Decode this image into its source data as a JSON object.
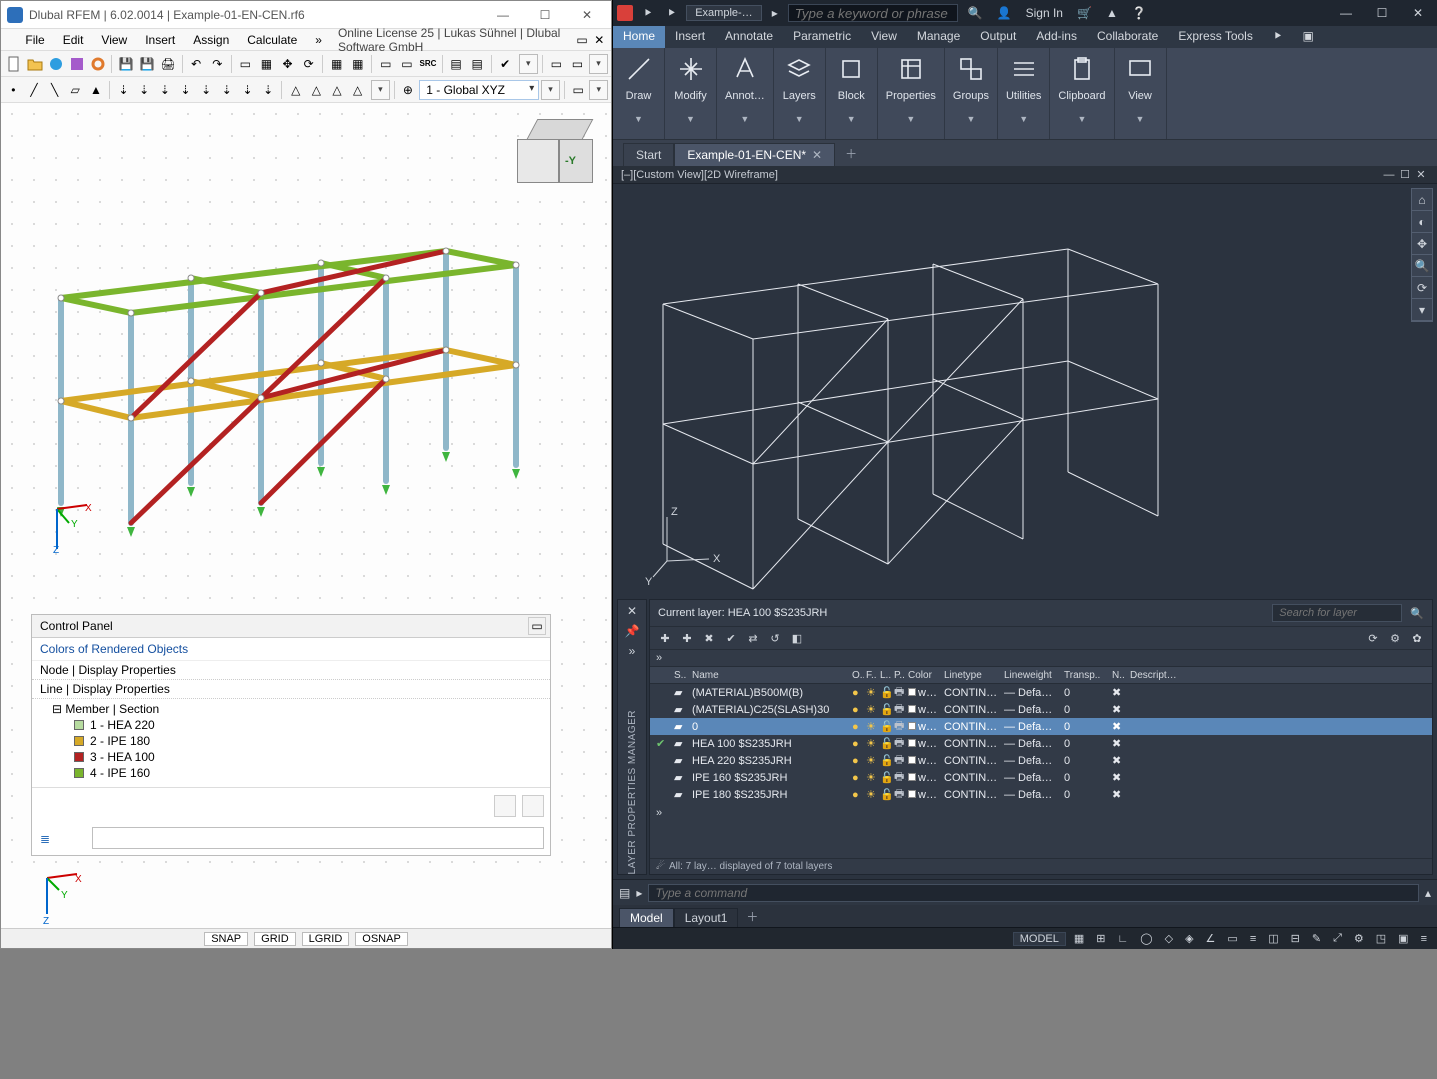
{
  "left": {
    "title": "Dlubal RFEM | 6.02.0014 | Example-01-EN-CEN.rf6",
    "menu": [
      "File",
      "Edit",
      "View",
      "Insert",
      "Assign",
      "Calculate"
    ],
    "menu_overflow": "»",
    "right_info": "Online License 25 | Lukas Sühnel | Dlubal Software GmbH",
    "coord_system": "1 - Global XYZ",
    "nav_cube_label": "-Y",
    "axis": {
      "x": "X",
      "y": "Y",
      "z": "Z"
    },
    "control_panel": {
      "title": "Control Panel",
      "subtitle": "Colors of Rendered Objects",
      "rows": [
        "Node | Display Properties",
        "Line | Display Properties"
      ],
      "tree_root": "Member | Section",
      "items": [
        {
          "label": "1 - HEA 220",
          "color": "#b7dca0"
        },
        {
          "label": "2 - IPE 180",
          "color": "#d6a927"
        },
        {
          "label": "3 - HEA 100",
          "color": "#b32222"
        },
        {
          "label": "4 - IPE 160",
          "color": "#7ab52d"
        }
      ]
    },
    "status": [
      "SNAP",
      "GRID",
      "LGRID",
      "OSNAP"
    ]
  },
  "right": {
    "doc_tab": "Example-…",
    "search_ph": "Type a keyword or phrase",
    "signin": "Sign In",
    "menu": [
      "Home",
      "Insert",
      "Annotate",
      "Parametric",
      "View",
      "Manage",
      "Output",
      "Add-ins",
      "Collaborate",
      "Express Tools"
    ],
    "ribbon": [
      "Draw",
      "Modify",
      "Annot…",
      "Layers",
      "Block",
      "Properties",
      "Groups",
      "Utilities",
      "Clipboard",
      "View"
    ],
    "tabs": {
      "start": "Start",
      "active": "Example-01-EN-CEN*"
    },
    "view_label": "[–][Custom View][2D Wireframe]",
    "ucs": {
      "x": "X",
      "y": "Y",
      "z": "Z"
    },
    "layer_panel": {
      "current_label": "Current layer: HEA 100 $S235JRH",
      "search_ph": "Search for layer",
      "side_label": "LAYER PROPERTIES MANAGER",
      "columns": [
        "",
        "S..",
        "Name",
        "O..",
        "F..",
        "L..",
        "P..",
        "Color",
        "Linetype",
        "Lineweight",
        "Transp..",
        "N..",
        "Descript…"
      ],
      "rows": [
        {
          "name": "(MATERIAL)B500M(B)",
          "color": "wh…",
          "ltype": "CONTIN…",
          "lw": "—  Defa…",
          "tr": "0"
        },
        {
          "name": "(MATERIAL)C25(SLASH)30",
          "color": "wh…",
          "ltype": "CONTIN…",
          "lw": "—  Defa…",
          "tr": "0"
        },
        {
          "name": "0",
          "color": "wh…",
          "ltype": "CONTIN…",
          "lw": "—  Defa…",
          "tr": "0",
          "selected": true
        },
        {
          "name": "HEA 100 $S235JRH",
          "color": "wh…",
          "ltype": "CONTIN…",
          "lw": "—  Defa…",
          "tr": "0",
          "current": true
        },
        {
          "name": "HEA 220 $S235JRH",
          "color": "wh…",
          "ltype": "CONTIN…",
          "lw": "—  Defa…",
          "tr": "0"
        },
        {
          "name": "IPE 160 $S235JRH",
          "color": "wh…",
          "ltype": "CONTIN…",
          "lw": "—  Defa…",
          "tr": "0"
        },
        {
          "name": "IPE 180 $S235JRH",
          "color": "wh…",
          "ltype": "CONTIN…",
          "lw": "—  Defa…",
          "tr": "0"
        }
      ],
      "footer": "All: 7 lay…   displayed of 7 total layers"
    },
    "cmd_ph": "Type a command",
    "bottom_tabs": [
      "Model",
      "Layout1"
    ],
    "status_left": "MODEL"
  }
}
